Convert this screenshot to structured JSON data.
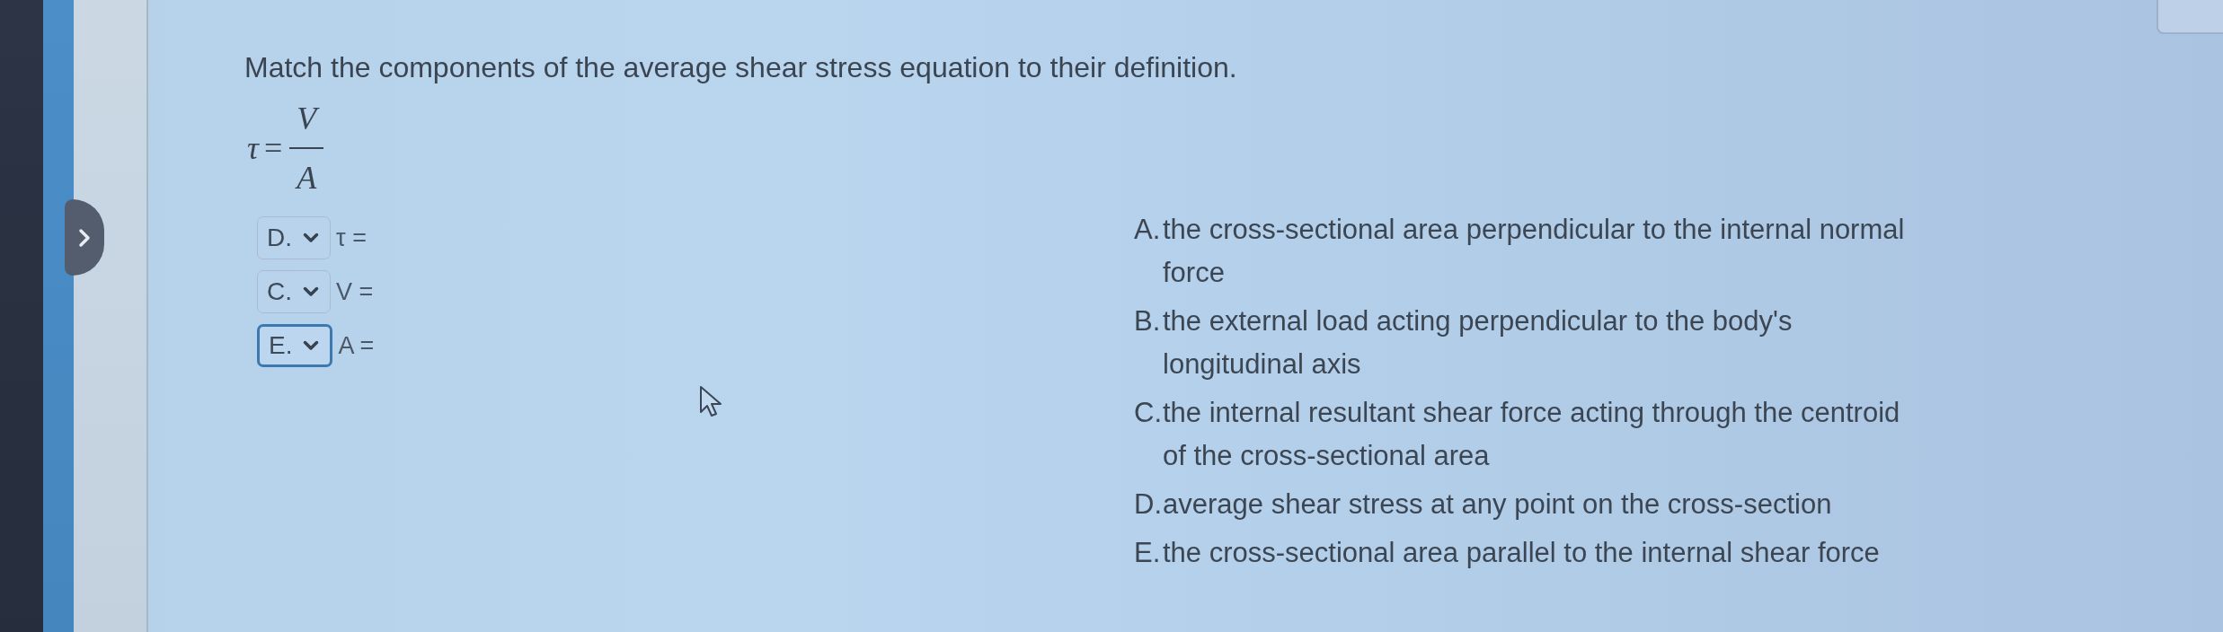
{
  "question": {
    "prompt": "Match the components of the average shear stress equation to their definition.",
    "equation": {
      "symbol": "τ",
      "equals": "=",
      "numerator": "V",
      "denominator": "A"
    }
  },
  "matches": [
    {
      "answer": "D.",
      "term": "τ =",
      "focused": false
    },
    {
      "answer": "C.",
      "term": "V =",
      "focused": false
    },
    {
      "answer": "E.",
      "term": "A =",
      "focused": true
    }
  ],
  "definitions": [
    {
      "letter": "A.",
      "text": "the cross-sectional area perpendicular to the internal normal force"
    },
    {
      "letter": "B.",
      "text": "the external load acting perpendicular to the body's longitudinal axis"
    },
    {
      "letter": "C.",
      "text": "the internal resultant shear force acting through the centroid of the cross-sectional area"
    },
    {
      "letter": "D.",
      "text": "average shear stress at any point on the cross-section"
    },
    {
      "letter": "E.",
      "text": "the cross-sectional area parallel to the internal shear force"
    }
  ]
}
